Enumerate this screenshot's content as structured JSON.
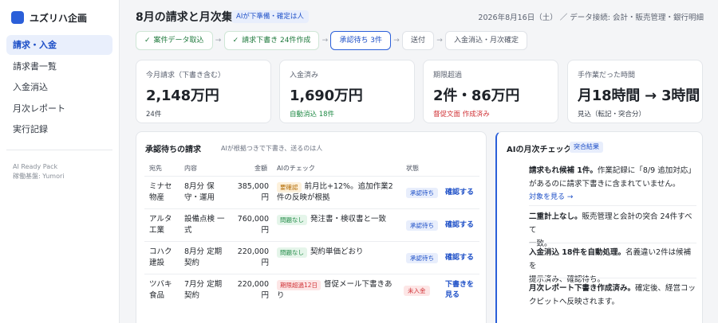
{
  "brand": {
    "name": "ユズリハ企画",
    "accent": "#2b5fd9"
  },
  "sidebar": {
    "items": [
      {
        "label": "請求・入金",
        "active": true
      },
      {
        "label": "請求書一覧"
      },
      {
        "label": "入金消込"
      },
      {
        "label": "月次レポート"
      },
      {
        "label": "実行記録"
      }
    ],
    "footer_line1": "AI Ready Pack",
    "footer_line2": "稼働基盤: Yumori"
  },
  "header": {
    "title": "8月の請求と月次集計",
    "badge": "AIが下準備・確定は人",
    "meta": "2026年8月16日（土） ／ データ接続: 会計・販売管理・銀行明細"
  },
  "pipeline": {
    "steps": [
      {
        "label": "案件データ取込",
        "state": "done"
      },
      {
        "label": "請求下書き 24件作成",
        "state": "done"
      },
      {
        "label": "承認待ち 3件",
        "state": "current"
      },
      {
        "label": "送付",
        "state": "todo"
      },
      {
        "label": "入金消込・月次確定",
        "state": "todo"
      }
    ],
    "done_mark": "✓",
    "arrow": "→"
  },
  "kpis": [
    {
      "label": "今月請求（下書き含む）",
      "value": "2,148万円",
      "sub": "24件"
    },
    {
      "label": "入金済み",
      "value": "1,690万円",
      "sub": "自動消込 18件"
    },
    {
      "label": "期限超過",
      "value": "2件・86万円",
      "sub": "督促文面 作成済み"
    },
    {
      "label": "手作業だった時間",
      "value": "月18時間 → 3時間",
      "sub": "見込（転記・突合分）"
    }
  ],
  "approvals": {
    "title": "承認待ちの請求",
    "note": "AIが根拠つきで下書き、送るのは人",
    "headers": {
      "client": "宛先",
      "content": "内容",
      "amount": "金額",
      "check": "AIのチェック",
      "status": "状態"
    },
    "rows": [
      {
        "client_1": "ミナセ",
        "client_2": "物産",
        "content_1": "8月分 保",
        "content_2": "守・運用",
        "amount_1": "385,000",
        "amount_2": "円",
        "tag": "要確認",
        "check_1": "前月比+12%。追加作業2",
        "check_2": "件の反映が根拠",
        "status": "承認待ち",
        "action_1": "確認する",
        "action_2": ""
      },
      {
        "client_1": "アルタ",
        "client_2": "工業",
        "content_1": "設備点検 一",
        "content_2": "式",
        "amount_1": "760,000",
        "amount_2": "円",
        "tag": "問題なし",
        "check_1": "発注書・検収書と一致",
        "check_2": "",
        "status": "承認待ち",
        "action_1": "確認する",
        "action_2": ""
      },
      {
        "client_1": "コハク",
        "client_2": "建設",
        "content_1": "8月分 定期",
        "content_2": "契約",
        "amount_1": "220,000",
        "amount_2": "円",
        "tag": "問題なし",
        "check_1": "契約単価どおり",
        "check_2": "",
        "status": "承認待ち",
        "action_1": "確認する",
        "action_2": ""
      },
      {
        "client_1": "ツバキ",
        "client_2": "食品",
        "content_1": "7月分 定期",
        "content_2": "契約",
        "amount_1": "220,000",
        "amount_2": "円",
        "tag": "期限超過12日",
        "check_1": "督促メール下書きあ",
        "check_2": "り",
        "status": "未入金",
        "action_1": "下書きを",
        "action_2": "見る"
      }
    ]
  },
  "ai_check": {
    "title": "AIの月次チェック",
    "tag": "突合結果",
    "items": [
      {
        "bold": "請求もれ候補 1件。",
        "line1_rest": "作業記録に「8/9 追加対応」",
        "line2": "があるのに請求下書きに含まれていません。",
        "link": "対象を見る →"
      },
      {
        "bold": "二重計上なし。",
        "line1_rest": "販売管理と会計の突合 24件すべて",
        "line2": "一致。"
      },
      {
        "bold": "入金消込 18件を自動処理。",
        "line1_rest": "名義違い2件は候補を",
        "line2": "提示済み、確認待ち。"
      },
      {
        "bold": "月次レポート下書き作成済み。",
        "line1_rest": "確定後、経営コッ",
        "line2": "クピットへ反映されます。"
      }
    ]
  }
}
